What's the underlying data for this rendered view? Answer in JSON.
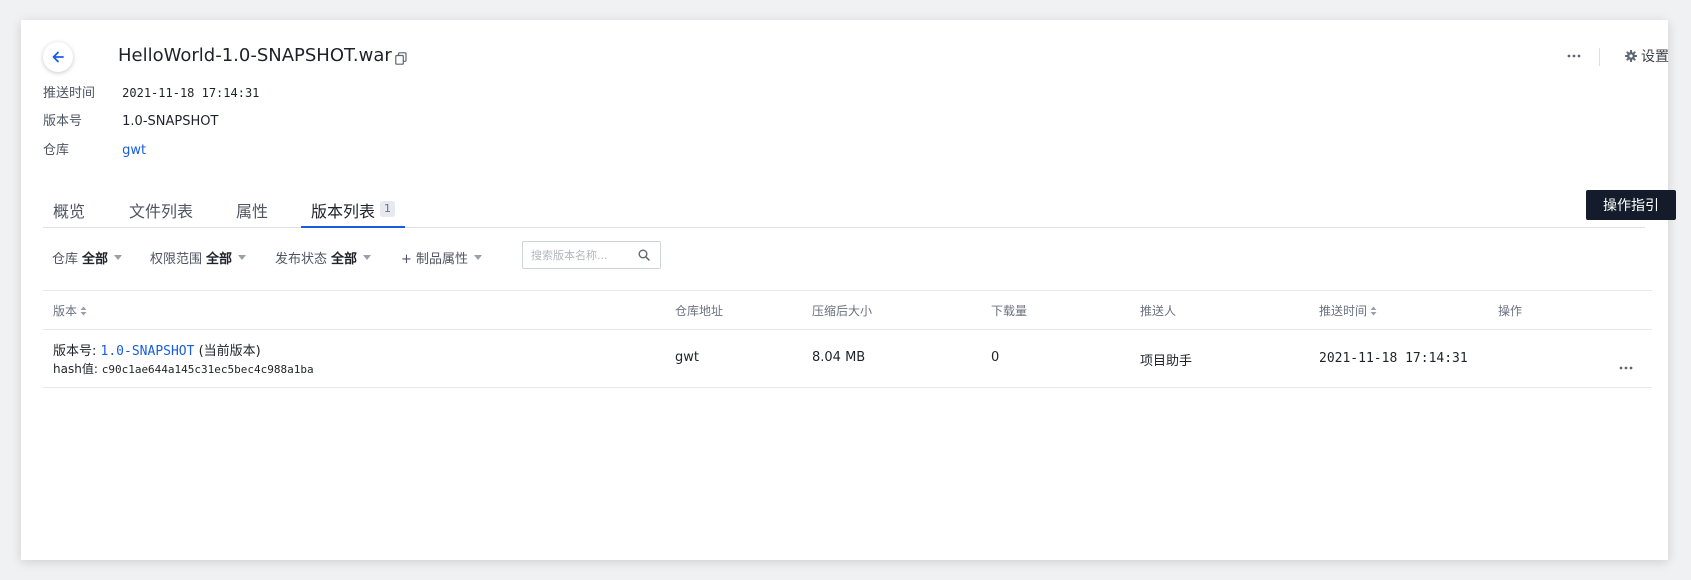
{
  "header": {
    "title": "HelloWorld-1.0-SNAPSHOT.war",
    "settings_label": "设置"
  },
  "info": [
    {
      "label": "推送时间",
      "value": "2021-11-18 17:14:31"
    },
    {
      "label": "版本号",
      "value": "1.0-SNAPSHOT"
    },
    {
      "label": "仓库",
      "value": "gwt"
    }
  ],
  "tabs": [
    {
      "label": "概览"
    },
    {
      "label": "文件列表"
    },
    {
      "label": "属性"
    },
    {
      "label": "版本列表",
      "badge": "1",
      "active": true
    }
  ],
  "guide_button": "操作指引",
  "filters": [
    {
      "label": "仓库",
      "value": "全部"
    },
    {
      "label": "权限范围",
      "value": "全部"
    },
    {
      "label": "发布状态",
      "value": "全部"
    },
    {
      "label": "+ 制品属性"
    }
  ],
  "search": {
    "placeholder": "搜索版本名称..."
  },
  "table": {
    "headers": [
      "版本",
      "仓库地址",
      "压缩后大小",
      "下载量",
      "推送人",
      "推送时间",
      "操作"
    ],
    "rows": [
      {
        "version_label": "版本号:",
        "version": "1.0-SNAPSHOT",
        "current_tag": "(当前版本)",
        "hash_label": "hash值:",
        "hash": "c90c1ae644a145c31ec5bec4c988a1ba",
        "repo": "gwt",
        "size": "8.04 MB",
        "downloads": "0",
        "pusher": "项目助手",
        "pushed_at": "2021-11-18 17:14:31"
      }
    ]
  },
  "colors": {
    "accent": "#1a5ce0",
    "primary_button": "#141c2c",
    "border": "#e6e8ec"
  }
}
